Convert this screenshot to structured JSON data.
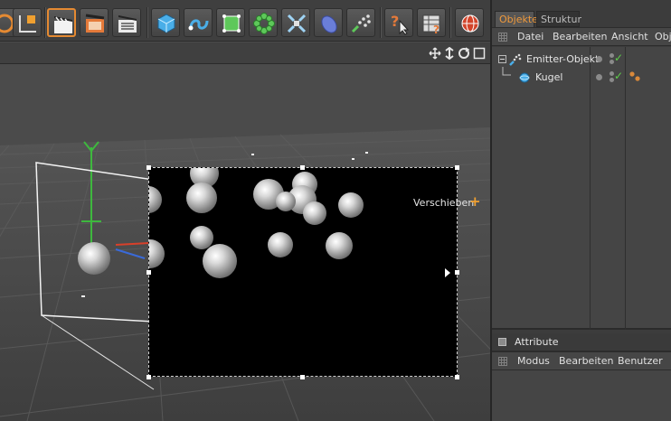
{
  "toolbar": {
    "buttons": [
      {
        "name": "move-tool-icon",
        "active": false
      },
      {
        "name": "world-axis-icon",
        "active": false
      },
      {
        "name": "render-view-clapper-icon",
        "active": true
      },
      {
        "name": "render-picture-viewer-icon",
        "active": false
      },
      {
        "name": "render-settings-icon",
        "active": false
      },
      {
        "name": "cube-icon",
        "active": false
      },
      {
        "name": "spline-pen-icon",
        "active": false
      },
      {
        "name": "nurbs-icon",
        "active": false
      },
      {
        "name": "array-cloner-icon",
        "active": false
      },
      {
        "name": "deformer-icon",
        "active": false
      },
      {
        "name": "scene-camera-icon",
        "active": false
      },
      {
        "name": "particles-icon",
        "active": false
      },
      {
        "name": "help-cursor-icon",
        "active": false
      },
      {
        "name": "timeline-help-icon",
        "active": false
      },
      {
        "name": "globe-icon",
        "active": false
      }
    ]
  },
  "viewport": {
    "move_label": "Verschieben",
    "move_plus": "+"
  },
  "panel": {
    "tabs": {
      "objects": "Objekte",
      "structure": "Struktur"
    },
    "menu": [
      "Datei",
      "Bearbeiten",
      "Ansicht",
      "Obje"
    ],
    "objects": [
      {
        "name": "Emitter-Objekt",
        "icon": "emitter-icon"
      },
      {
        "name": "Kugel",
        "icon": "sphere-icon"
      }
    ],
    "attributes": {
      "title": "Attribute",
      "menu": [
        "Modus",
        "Bearbeiten",
        "Benutzer"
      ]
    }
  },
  "colors": {
    "accent": "#e58a32",
    "check": "#5fcf4a",
    "viewport_bg": "#4b4b4b",
    "render_bg": "#000000"
  }
}
